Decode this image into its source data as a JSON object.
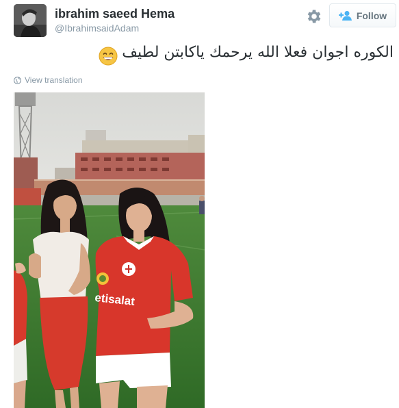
{
  "user": {
    "display_name": "ibrahim saeed Hema",
    "handle": "@IbrahimsaidAdam",
    "avatar_icon": "user-avatar"
  },
  "actions": {
    "settings_icon": "gear-icon",
    "follow_icon": "add-person-icon",
    "follow_label": "Follow"
  },
  "tweet": {
    "text": "الكوره اجوان فعلا الله يرحمك ياكابتن لطيف",
    "emoji_icon": "grinning-face-emoji-icon",
    "view_translation": "View translation",
    "translation_icon": "globe-icon"
  },
  "media": {
    "type": "photo",
    "jersey_text": "etisalat"
  },
  "colors": {
    "text_primary": "#292f33",
    "text_secondary": "#8899a6",
    "button_text": "#66757f",
    "button_border": "#e1e8ed"
  }
}
